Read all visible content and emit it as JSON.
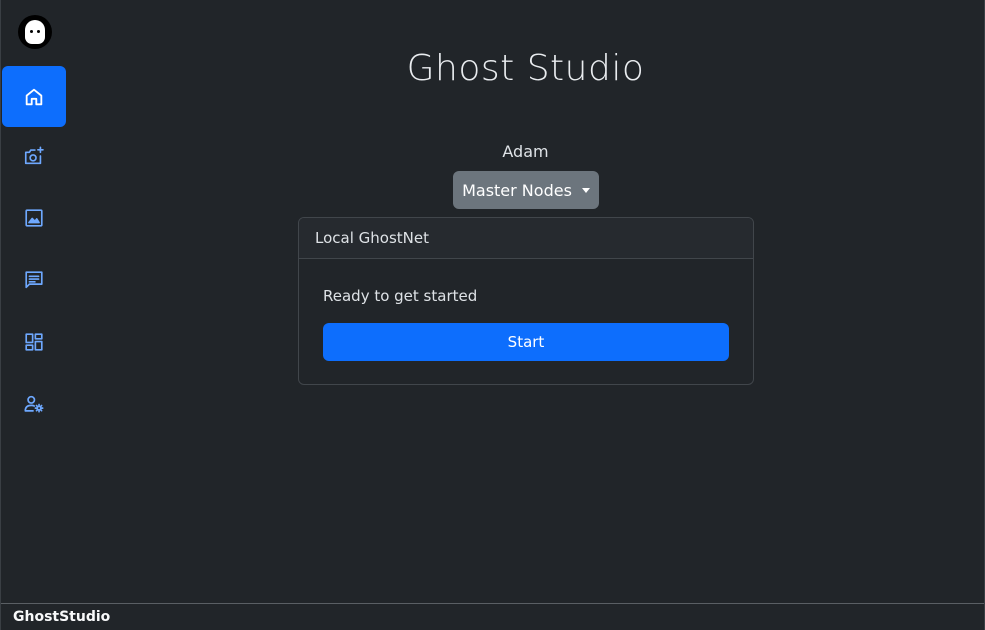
{
  "app": {
    "title": "Ghost Studio",
    "statusbar_label": "GhostStudio"
  },
  "sidebar": {
    "items": [
      {
        "icon": "home-icon",
        "active": true
      },
      {
        "icon": "camera-add-icon",
        "active": false
      },
      {
        "icon": "image-icon",
        "active": false
      },
      {
        "icon": "message-icon",
        "active": false
      },
      {
        "icon": "dashboard-icon",
        "active": false
      },
      {
        "icon": "user-settings-icon",
        "active": false
      }
    ]
  },
  "main": {
    "username": "Adam",
    "dropdown_label": "Master Nodes",
    "card": {
      "header": "Local GhostNet",
      "text": "Ready to get started",
      "button_label": "Start"
    }
  },
  "colors": {
    "background": "#212529",
    "accent": "#0d6efd",
    "icon": "#6ea8fe",
    "secondary_button": "#6c757d"
  }
}
